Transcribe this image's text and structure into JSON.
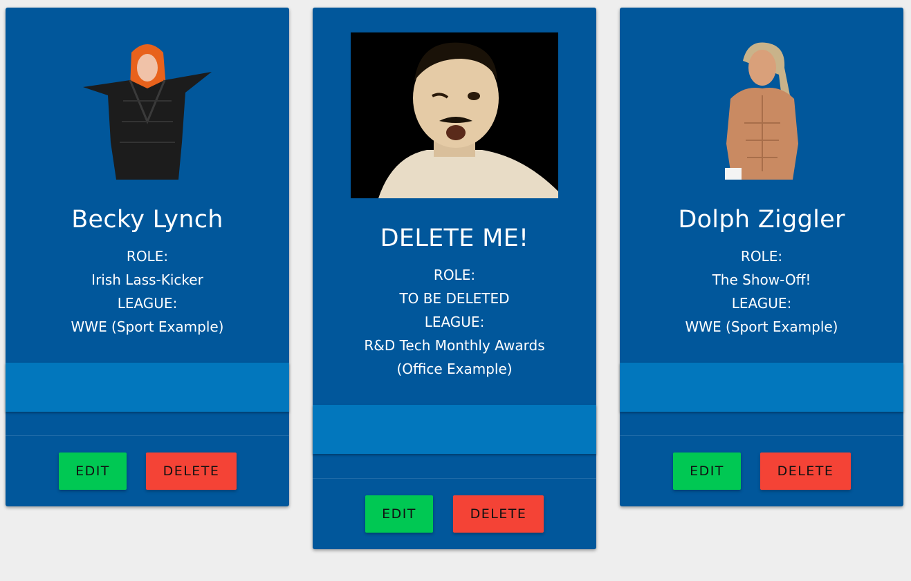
{
  "cards": [
    {
      "name": "Becky Lynch",
      "role_label": "ROLE:",
      "role": "Irish Lass-Kicker",
      "league_label": "LEAGUE:",
      "league": "WWE (Sport Example)",
      "edit_label": "EDIT",
      "delete_label": "DELETE"
    },
    {
      "name": "DELETE ME!",
      "role_label": "ROLE:",
      "role": "TO BE DELETED",
      "league_label": "LEAGUE:",
      "league": "R&D Tech Monthly Awards (Office Example)",
      "edit_label": "EDIT",
      "delete_label": "DELETE"
    },
    {
      "name": "Dolph Ziggler",
      "role_label": "ROLE:",
      "role": "The Show-Off!",
      "league_label": "LEAGUE:",
      "league": "WWE (Sport Example)",
      "edit_label": "EDIT",
      "delete_label": "DELETE"
    }
  ],
  "colors": {
    "background": "#eeeeee",
    "card": "#01579b",
    "band": "#0277bd",
    "edit": "#00c853",
    "delete": "#f44336"
  }
}
